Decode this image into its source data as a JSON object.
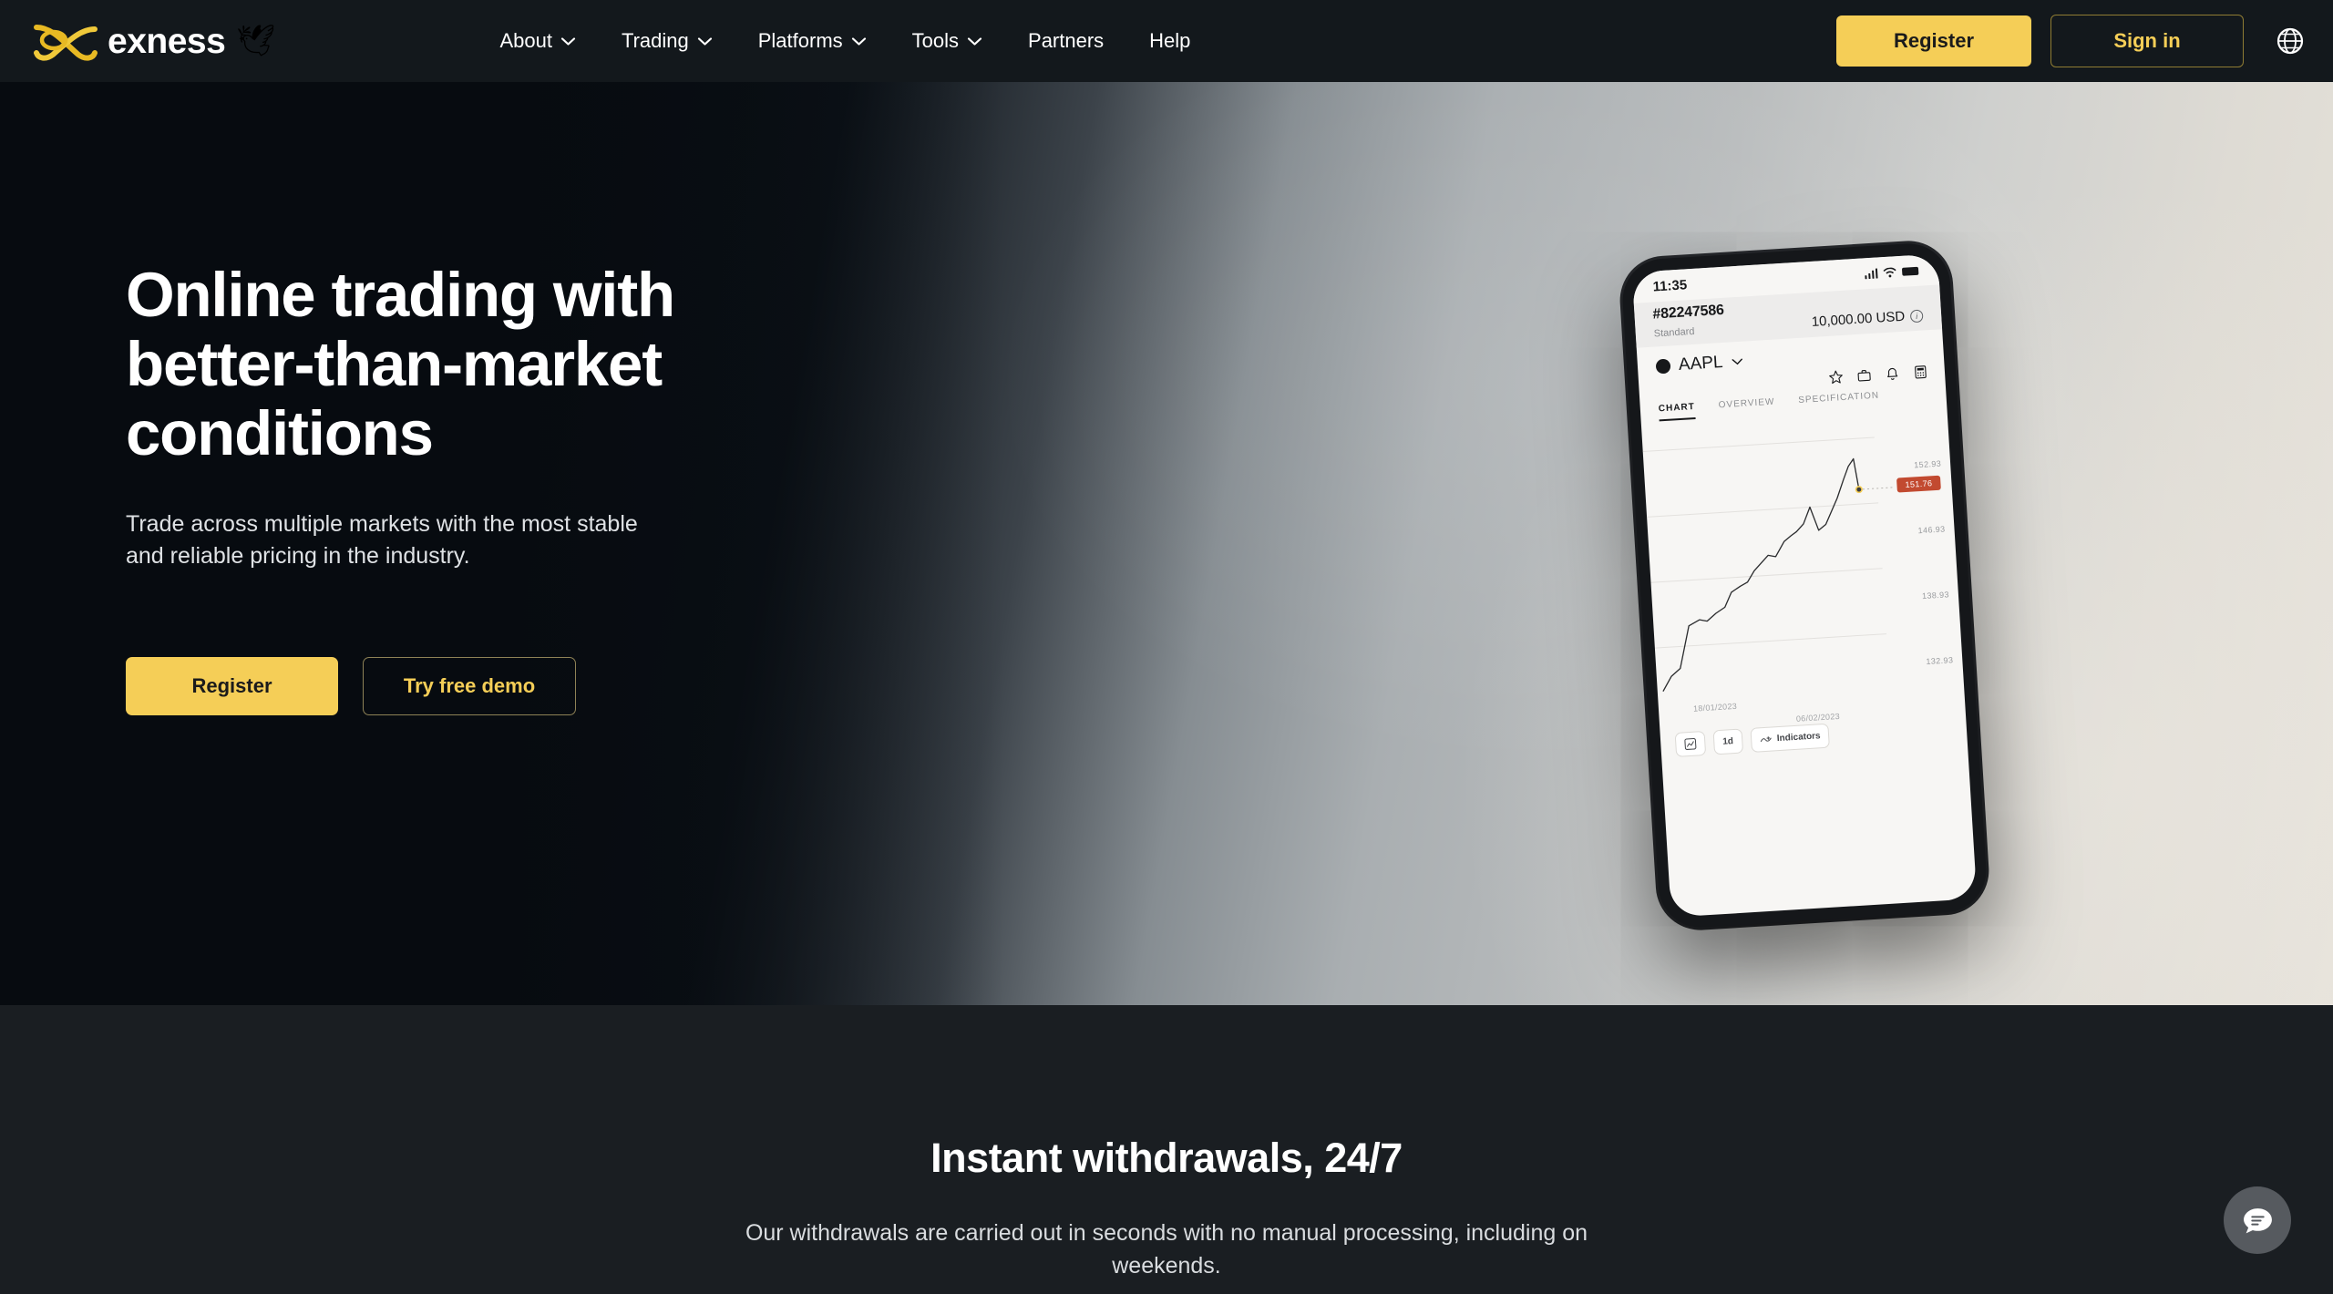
{
  "header": {
    "logo": {
      "mark_icon": "exness-infinity-mark-icon",
      "text": "exness",
      "dove_icon": "dove-emoji",
      "dove_glyph": "🕊",
      "brand_color": "#F5CE57"
    },
    "nav": [
      {
        "label": "About",
        "has_dropdown": true,
        "icon": "chevron-down-icon"
      },
      {
        "label": "Trading",
        "has_dropdown": true,
        "icon": "chevron-down-icon"
      },
      {
        "label": "Platforms",
        "has_dropdown": true,
        "icon": "chevron-down-icon"
      },
      {
        "label": "Tools",
        "has_dropdown": true,
        "icon": "chevron-down-icon"
      },
      {
        "label": "Partners",
        "has_dropdown": false,
        "icon": ""
      },
      {
        "label": "Help",
        "has_dropdown": false,
        "icon": ""
      }
    ],
    "register_label": "Register",
    "signin_label": "Sign in",
    "language_icon": "globe-icon"
  },
  "hero": {
    "title_line1": "Online trading with",
    "title_line2": "better-than-market",
    "title_line3": "conditions",
    "subtitle": "Trade across multiple markets with the most stable and reliable pricing in the industry.",
    "register_label": "Register",
    "demo_label": "Try free demo",
    "phone": {
      "time": "11:35",
      "account_id": "#82247586",
      "account_type": "Standard",
      "balance": "10,000.00 USD",
      "info_icon": "info-icon",
      "symbol": "AAPL",
      "symbol_chevron_icon": "chevron-down-icon",
      "tools": [
        "star-icon",
        "briefcase-icon",
        "bell-icon",
        "calculator-icon"
      ],
      "tabs": [
        "CHART",
        "OVERVIEW",
        "SPECIFICATION"
      ],
      "active_tab": "CHART",
      "price_labels": [
        "152.93",
        "146.93",
        "138.93",
        "132.93"
      ],
      "current_price": "151.76",
      "current_price_color": "#c24a30",
      "date_start": "18/01/2023",
      "date_end": "06/02/2023",
      "footer_buttons": [
        "chart-type-icon",
        "1d",
        "Indicators"
      ],
      "indicators_label": "Indicators",
      "timeframe_label": "1d"
    }
  },
  "section2": {
    "title": "Instant withdrawals, 24/7",
    "subtitle": "Our withdrawals are carried out in seconds with no manual processing, including on weekends."
  },
  "chat": {
    "icon": "chat-bubble-icon"
  }
}
